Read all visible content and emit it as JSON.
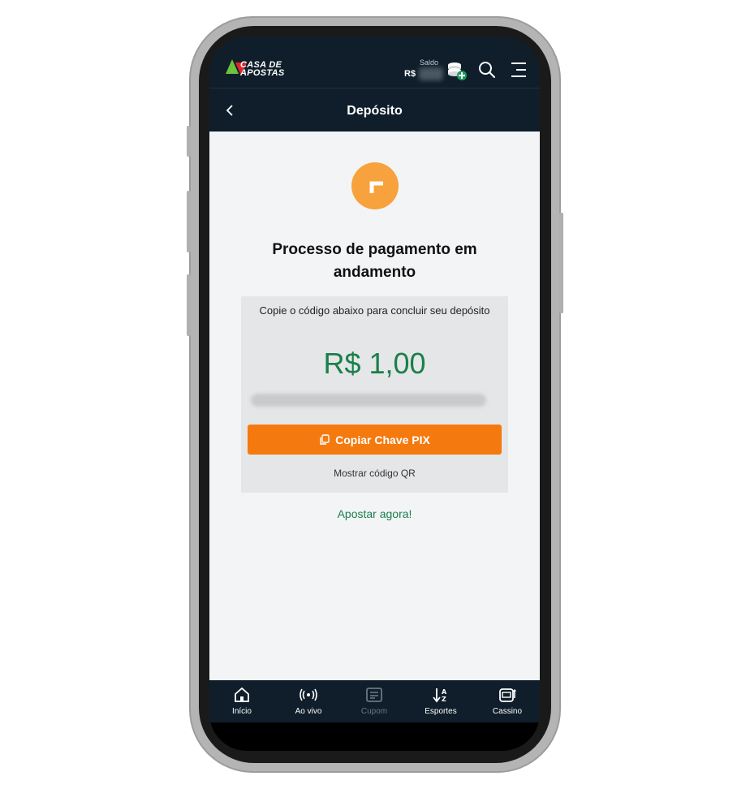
{
  "header": {
    "logo_line1": "CASA DE",
    "logo_line2": "APOSTAS",
    "saldo_label": "Saldo",
    "currency": "R$",
    "page_title": "Depósito"
  },
  "main": {
    "heading": "Processo de pagamento em andamento",
    "instruction": "Copie o código abaixo para concluir seu depósito",
    "amount": "R$ 1,00",
    "copy_button_label": "Copiar Chave PIX",
    "qr_link": "Mostrar código QR",
    "bet_link": "Apostar agora!"
  },
  "bottom_nav": [
    {
      "label": "Início",
      "icon": "home-icon"
    },
    {
      "label": "Ao vivo",
      "icon": "live-icon"
    },
    {
      "label": "Cupom",
      "icon": "coupon-icon"
    },
    {
      "label": "Esportes",
      "icon": "sports-sort-icon"
    },
    {
      "label": "Cassino",
      "icon": "slot-machine-icon"
    }
  ],
  "colors": {
    "brand_dark": "#0f1e2a",
    "accent_orange": "#f47a10",
    "status_orange": "#f7a23c",
    "green": "#1a7f4b"
  }
}
